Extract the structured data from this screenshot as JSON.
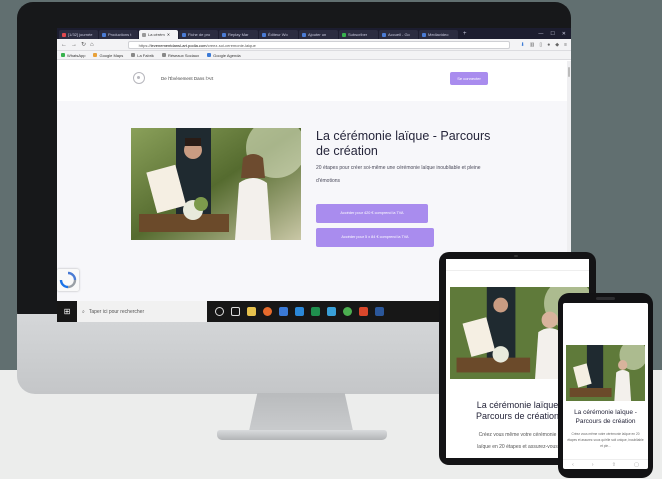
{
  "browser": {
    "tabs": [
      "[1/32] journée",
      "Productions t",
      "La cérém",
      "Fiche de pro",
      "Replay Mar",
      "Éditeur Wo",
      "Ajouter un",
      "Subscriber",
      "Accueil - Go",
      "Mediavideo"
    ],
    "active_tab_index": 2,
    "url_host": "levenementdansl-art.podia.com",
    "url_prefix": "https://",
    "url_path": "/creez-soi-ceremonie-laique",
    "bookmarks": [
      "WhatsApp",
      "Google Maps",
      "La Fabrik",
      "Réseaux Sociaux",
      "Google Agenda"
    ]
  },
  "site": {
    "name": "De l'Événement Dans l'Art",
    "header_button": "Se connecter",
    "hero": {
      "title": "La cérémonie laïque - Parcours de création",
      "subtitle": "20 étapes pour créer soi-même une cérémonie laïque inoubliable et pleine d'émotions",
      "cta_primary": "Accéder pour 420 € comprend la TVA",
      "cta_secondary": "Accéder pour 5 x 84 € comprend la TVA"
    }
  },
  "taskbar": {
    "search_placeholder": "Taper ici pour rechercher"
  },
  "tablet": {
    "title_line1": "La cérémonie laïque",
    "title_line2": "Parcours de création",
    "text_line1": "Créez vous même votre cérémonie",
    "text_line2": "laïque en 20 étapes et assurez-vous"
  },
  "phone": {
    "title": "La cérémonie laïque - Parcours de création",
    "text": "Créez vous même votre cérémonie laïque en 20 étapes et assurez-vous qu'elle soit unique, inoubliable et ple..."
  },
  "colors": {
    "accent": "#a98cee",
    "background": "#616f70",
    "floor": "#ecedec"
  }
}
